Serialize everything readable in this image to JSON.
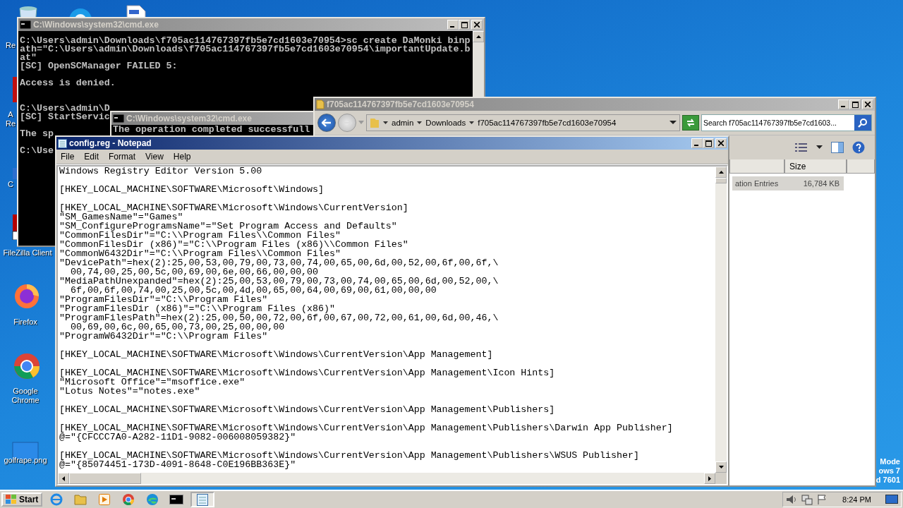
{
  "desktop": {
    "icons": [
      {
        "kind": "recycle",
        "label": "Re"
      },
      {
        "kind": "skype"
      },
      {
        "kind": "file"
      },
      {
        "kind": "acrobat",
        "label": "A Re"
      },
      {
        "kind": "ccleaner",
        "label": "C"
      },
      {
        "kind": "filezilla",
        "label": "FileZilla Client"
      },
      {
        "kind": "firefox",
        "label": "Firefox"
      },
      {
        "kind": "chrome",
        "label": "Google Chrome"
      },
      {
        "kind": "image",
        "label": "golfrape.png"
      }
    ],
    "corner_text": [
      "Mode",
      "ows 7",
      "d 7601"
    ]
  },
  "cmd_back": {
    "title": "C:\\Windows\\system32\\cmd.exe",
    "output": "C:\\Users\\admin\\Downloads\\f705ac114767397fb5e7cd1603e70954>sc create DaMonki binp\nath=\"C:\\Users\\admin\\Downloads\\f705ac114767397fb5e7cd1603e70954\\importantUpdate.b\nat\"\n[SC] OpenSCManager FAILED 5:\n\nAccess is denied.\n\n\nC:\\Users\\admin\\D\n[SC] StartServic\n\nThe sp\n\nC:\\Use"
  },
  "cmd_front": {
    "title": "C:\\Windows\\system32\\cmd.exe",
    "output": "The operation completed successfull"
  },
  "explorer": {
    "title": "f705ac114767397fb5e7cd1603e70954",
    "breadcrumbs": [
      "admin",
      "Downloads",
      "f705ac114767397fb5e7cd1603e70954"
    ],
    "search": {
      "placeholder": "Search f705ac114767397fb5e7cd1603..."
    },
    "columns": [
      "Size"
    ],
    "rows": [
      {
        "name": "ation Entries",
        "size": "16,784 KB",
        "selected": true
      }
    ]
  },
  "notepad": {
    "title": "config.reg - Notepad",
    "menu": [
      "File",
      "Edit",
      "Format",
      "View",
      "Help"
    ],
    "text": "Windows Registry Editor Version 5.00\n\n[HKEY_LOCAL_MACHINE\\SOFTWARE\\Microsoft\\Windows]\n\n[HKEY_LOCAL_MACHINE\\SOFTWARE\\Microsoft\\Windows\\CurrentVersion]\n\"SM_GamesName\"=\"Games\"\n\"SM_ConfigureProgramsName\"=\"Set Program Access and Defaults\"\n\"CommonFilesDir\"=\"C:\\\\Program Files\\\\Common Files\"\n\"CommonFilesDir (x86)\"=\"C:\\\\Program Files (x86)\\\\Common Files\"\n\"CommonW6432Dir\"=\"C:\\\\Program Files\\\\Common Files\"\n\"DevicePath\"=hex(2):25,00,53,00,79,00,73,00,74,00,65,00,6d,00,52,00,6f,00,6f,\\\n  00,74,00,25,00,5c,00,69,00,6e,00,66,00,00,00\n\"MediaPathUnexpanded\"=hex(2):25,00,53,00,79,00,73,00,74,00,65,00,6d,00,52,00,\\\n  6f,00,6f,00,74,00,25,00,5c,00,4d,00,65,00,64,00,69,00,61,00,00,00\n\"ProgramFilesDir\"=\"C:\\\\Program Files\"\n\"ProgramFilesDir (x86)\"=\"C:\\\\Program Files (x86)\"\n\"ProgramFilesPath\"=hex(2):25,00,50,00,72,00,6f,00,67,00,72,00,61,00,6d,00,46,\\\n  00,69,00,6c,00,65,00,73,00,25,00,00,00\n\"ProgramW6432Dir\"=\"C:\\\\Program Files\"\n\n[HKEY_LOCAL_MACHINE\\SOFTWARE\\Microsoft\\Windows\\CurrentVersion\\App Management]\n\n[HKEY_LOCAL_MACHINE\\SOFTWARE\\Microsoft\\Windows\\CurrentVersion\\App Management\\Icon Hints]\n\"Microsoft Office\"=\"msoffice.exe\"\n\"Lotus Notes\"=\"notes.exe\"\n\n[HKEY_LOCAL_MACHINE\\SOFTWARE\\Microsoft\\Windows\\CurrentVersion\\App Management\\Publishers]\n\n[HKEY_LOCAL_MACHINE\\SOFTWARE\\Microsoft\\Windows\\CurrentVersion\\App Management\\Publishers\\Darwin App Publisher]\n@=\"{CFCCC7A0-A282-11D1-9082-006008059382}\"\n\n[HKEY_LOCAL_MACHINE\\SOFTWARE\\Microsoft\\Windows\\CurrentVersion\\App Management\\Publishers\\WSUS Publisher]\n@=\"{85074451-173D-4091-8648-C0E196BB363E}\""
  },
  "taskbar": {
    "start": "Start",
    "apps": [
      {
        "kind": "ie",
        "selected": false
      },
      {
        "kind": "folder",
        "selected": false
      },
      {
        "kind": "media",
        "selected": false
      },
      {
        "kind": "chrome",
        "selected": false
      },
      {
        "kind": "edge",
        "selected": false
      },
      {
        "kind": "cmd",
        "selected": false
      },
      {
        "kind": "notepad",
        "selected": true
      }
    ],
    "clock": "8:24 PM"
  }
}
